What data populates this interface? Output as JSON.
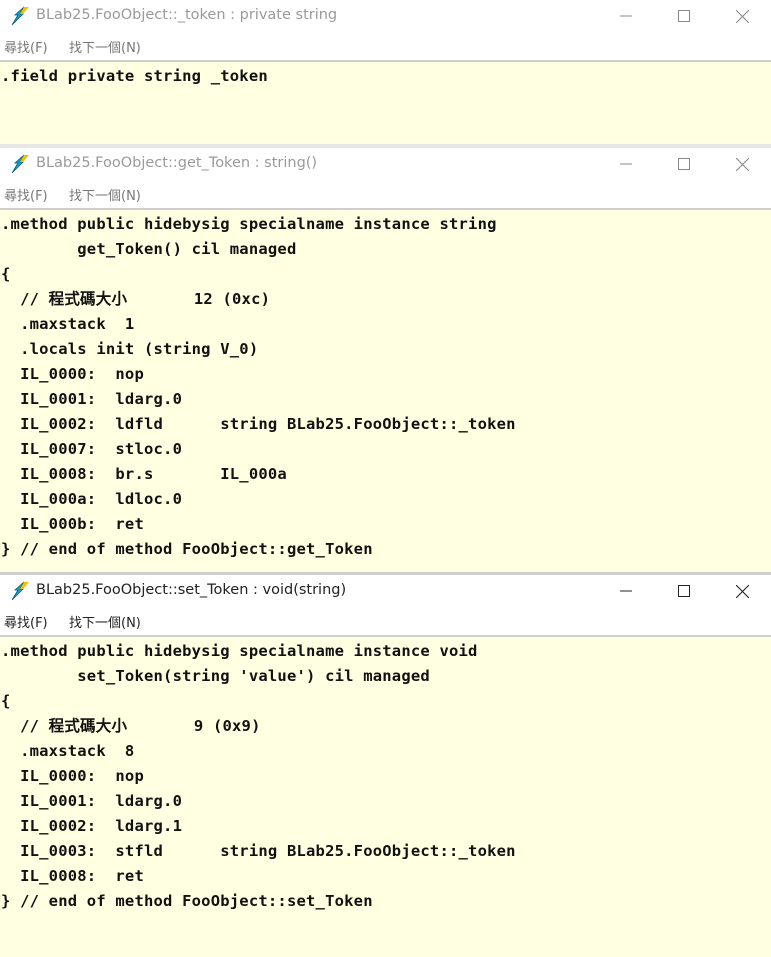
{
  "menu": {
    "find": "尋找(F)",
    "find_next": "找下一個(N)"
  },
  "windows": [
    {
      "title": "BLab25.FooObject::_token : private string",
      "code": ".field private string _token"
    },
    {
      "title": "BLab25.FooObject::get_Token : string()",
      "code": ".method public hidebysig specialname instance string\n        get_Token() cil managed\n{\n  // 程式碼大小       12 (0xc)\n  .maxstack  1\n  .locals init (string V_0)\n  IL_0000:  nop\n  IL_0001:  ldarg.0\n  IL_0002:  ldfld      string BLab25.FooObject::_token\n  IL_0007:  stloc.0\n  IL_0008:  br.s       IL_000a\n  IL_000a:  ldloc.0\n  IL_000b:  ret\n} // end of method FooObject::get_Token"
    },
    {
      "title": "BLab25.FooObject::set_Token : void(string)",
      "code": ".method public hidebysig specialname instance void\n        set_Token(string 'value') cil managed\n{\n  // 程式碼大小       9 (0x9)\n  .maxstack  8\n  IL_0000:  nop\n  IL_0001:  ldarg.0\n  IL_0002:  ldarg.1\n  IL_0003:  stfld      string BLab25.FooObject::_token\n  IL_0008:  ret\n} // end of method FooObject::set_Token"
    }
  ],
  "icons": {
    "app": "ildasm-lightning-icon",
    "minimize": "minimize-icon",
    "maximize": "maximize-icon",
    "close": "close-icon"
  }
}
